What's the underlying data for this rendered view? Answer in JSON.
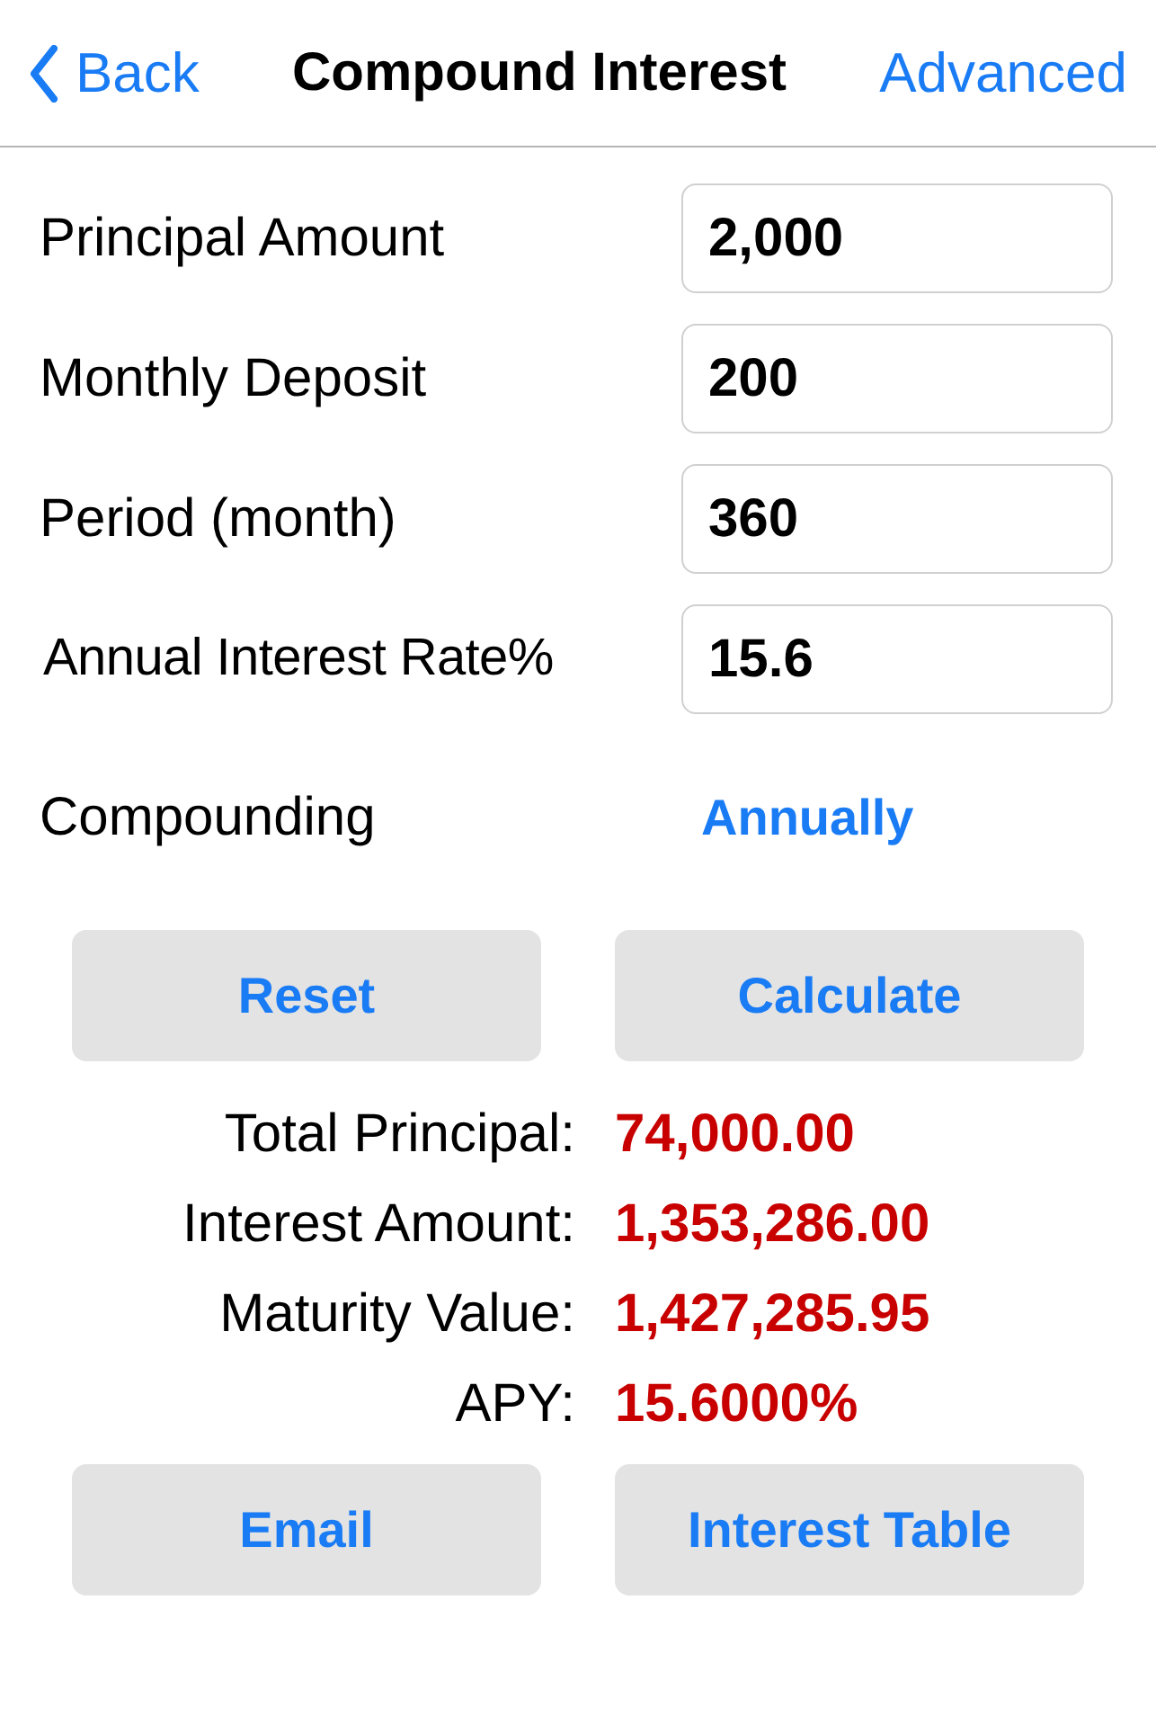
{
  "nav": {
    "back": "Back",
    "title": "Compound Interest",
    "action": "Advanced"
  },
  "fields": [
    {
      "label": "Principal Amount",
      "value": "2,000"
    },
    {
      "label": "Monthly Deposit",
      "value": "200"
    },
    {
      "label": "Period (month)",
      "value": "360"
    },
    {
      "label": "Annual Interest Rate%",
      "value": "15.6"
    }
  ],
  "compounding": {
    "label": "Compounding",
    "value": "Annually"
  },
  "buttons": [
    "Reset",
    "Calculate"
  ],
  "results": [
    {
      "label": "Total Principal:",
      "value": "74,000.00"
    },
    {
      "label": "Interest Amount:",
      "value": "1,353,286.00"
    },
    {
      "label": "Maturity Value:",
      "value": "1,427,285.95"
    },
    {
      "label": "APY:",
      "value": "15.6000%"
    }
  ],
  "bottom_buttons": [
    "Email",
    "Interest Table"
  ]
}
